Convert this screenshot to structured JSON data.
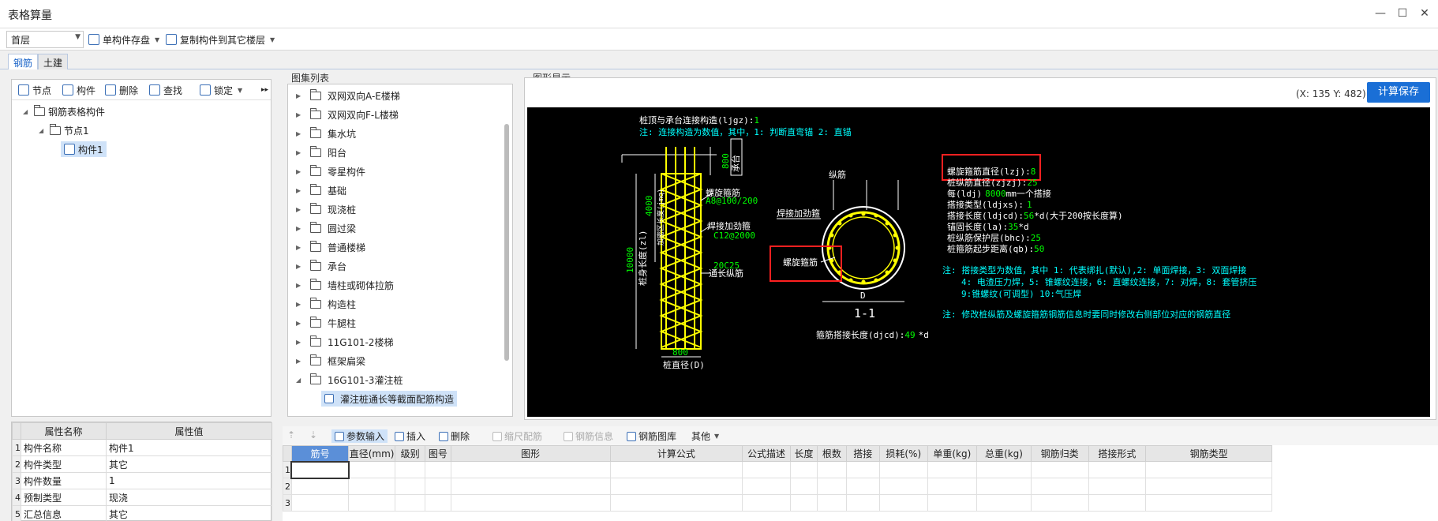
{
  "window": {
    "title": "表格算量"
  },
  "toolbar": {
    "floor": "首层",
    "save_component": "单构件存盘",
    "copy_to_floor": "复制构件到其它楼层"
  },
  "tabs": [
    "钢筋",
    "土建"
  ],
  "tree_panel": {
    "toolbar": [
      "节点",
      "构件",
      "删除",
      "查找",
      "锁定"
    ],
    "root": "钢筋表格构件",
    "node": "节点1",
    "component": "构件1"
  },
  "properties": {
    "headers": [
      "属性名称",
      "属性值"
    ],
    "rows": [
      {
        "num": "1",
        "name": "构件名称",
        "value": "构件1"
      },
      {
        "num": "2",
        "name": "构件类型",
        "value": "其它"
      },
      {
        "num": "3",
        "name": "构件数量",
        "value": "1"
      },
      {
        "num": "4",
        "name": "预制类型",
        "value": "现浇"
      },
      {
        "num": "5",
        "name": "汇总信息",
        "value": "其它"
      }
    ]
  },
  "atlas": {
    "caption": "图集列表",
    "items": [
      "双网双向A-E楼梯",
      "双网双向F-L楼梯",
      "集水坑",
      "阳台",
      "零星构件",
      "基础",
      "现浇桩",
      "圆过梁",
      "普通楼梯",
      "承台",
      "墙柱或砌体拉筋",
      "构造柱",
      "牛腿柱",
      "11G101-2楼梯",
      "框架扁梁",
      "16G101-3灌注桩"
    ],
    "selected": "灌注桩通长等截面配筋构造"
  },
  "graphic": {
    "caption": "图形显示",
    "coords": "(X: 135 Y: 482)",
    "calc_button": "计算保存",
    "drawing": {
      "top_note1_a": "桩顶与承台连接构造(ljgz):",
      "top_note1_b": "1",
      "top_note2": "注: 连接构造为数值，其中，1: 判断直弯锚     2: 直锚",
      "dim_800_top": "800",
      "anchor_label": "承台",
      "dim_4000": "4000",
      "dense_label": "加密区长度(jmq)",
      "dim_10000": "10000",
      "body_label": "桩身长度(zl)",
      "dim_800_bottom": "800",
      "pile_dia_label": "桩直径(D)",
      "spiral_label": "螺旋箍筋",
      "spiral_spec": "A8@100/200",
      "weld_label": "焊接加劲箍",
      "weld_spec": "C12@2000",
      "long_spec": "20C25",
      "long_label": "通长纵筋",
      "sec_long": "纵筋",
      "sec_weld": "焊接加劲箍",
      "sec_spiral": "螺旋箍筋",
      "sec_d": "D",
      "sec_title": "1-1",
      "stirrup_lap_a": "箍筋搭接长度(djcd):",
      "stirrup_lap_b": "49",
      "stirrup_lap_c": "*d",
      "params": [
        {
          "label": "螺旋箍筋直径(lzj):",
          "value": "8",
          "suffix": ""
        },
        {
          "label": "桩纵筋直径(zjzj):",
          "value": "25",
          "suffix": ""
        },
        {
          "label": "每(ldj)",
          "value": "8000",
          "suffix": "mm一个搭接"
        },
        {
          "label": "搭接类型(ldjxs):",
          "value": "1",
          "suffix": ""
        },
        {
          "label": "搭接长度(ldjcd):",
          "value": "56",
          "suffix": "*d(大于200按长度算)"
        },
        {
          "label": "锚固长度(la):",
          "value": "35",
          "suffix": "*d"
        },
        {
          "label": "桩纵筋保护层(bhc):",
          "value": "25",
          "suffix": ""
        },
        {
          "label": "桩箍筋起步距离(qb):",
          "value": "50",
          "suffix": ""
        }
      ],
      "note_a1": "注: 搭接类型为数值，其中 1: 代表绑扎(默认),2: 单面焊接，3: 双面焊接",
      "note_a2": "4: 电渣压力焊，5: 锥螺纹连接，6: 直螺纹连接，7: 对焊，8: 套管挤压",
      "note_a3": "9:锥螺纹(可调型) 10:气压焊",
      "note_b": "注: 修改桩纵筋及螺旋箍筋钢筋信息时要同时修改右侧部位对应的钢筋直径"
    }
  },
  "grid_toolbar": [
    "参数输入",
    "插入",
    "删除",
    "缩尺配筋",
    "钢筋信息",
    "钢筋图库",
    "其他"
  ],
  "grid": {
    "headers": [
      "筋号",
      "直径(mm)",
      "级别",
      "图号",
      "图形",
      "计算公式",
      "公式描述",
      "长度",
      "根数",
      "搭接",
      "损耗(%)",
      "单重(kg)",
      "总重(kg)",
      "钢筋归类",
      "搭接形式",
      "钢筋类型"
    ],
    "rows": [
      "1",
      "2",
      "3"
    ]
  },
  "colors": {
    "accent": "#1a6fd6",
    "drawing_bg": "#000000",
    "cad_yellow": "#ffff00",
    "cad_green": "#00ff00",
    "cad_cyan": "#00ffff",
    "highlight_red": "#ff2020"
  }
}
